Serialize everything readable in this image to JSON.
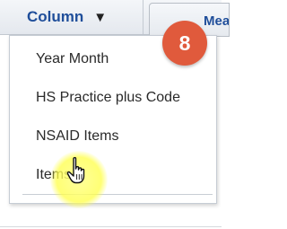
{
  "header": {
    "column_label": "Column",
    "caret_icon": "caret-down-icon",
    "next_tab_label": "Measures"
  },
  "step_badge": {
    "number": "8",
    "color": "#e05a3c"
  },
  "menu": {
    "items": [
      {
        "label": "Year Month"
      },
      {
        "label": "HS Practice plus Code"
      },
      {
        "label": "NSAID Items"
      },
      {
        "label": "Items"
      }
    ]
  },
  "cursor": {
    "icon": "hand-pointer-icon"
  },
  "colors": {
    "accent": "#1f4e9a",
    "highlight": "#ffff66"
  }
}
